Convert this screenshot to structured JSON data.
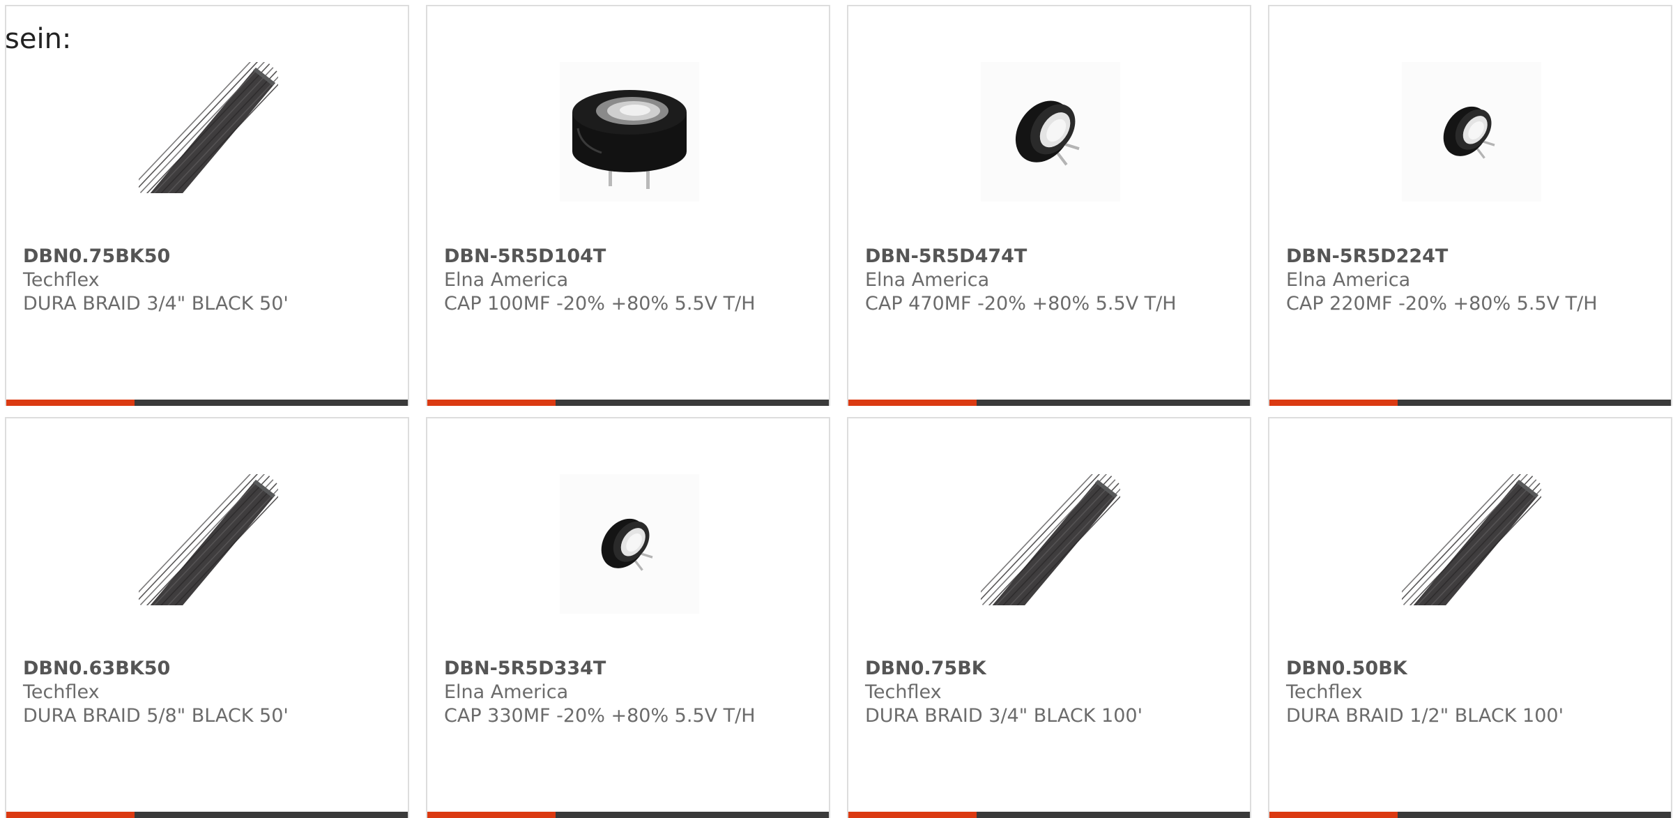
{
  "intro_text": "sein:",
  "colors": {
    "accent": "#db3a12",
    "bar_track": "#3a3a3a",
    "part_number": "#555555",
    "body_text": "#6b6b6b",
    "card_border": "#dddddd"
  },
  "products": [
    {
      "part_number": "DBN0.75BK50",
      "manufacturer": "Techflex",
      "description": "DURA BRAID 3/4\" BLACK 50'",
      "image": "black-braided-sleeve-icon",
      "bar_fill_fraction": 0.32
    },
    {
      "part_number": "DBN-5R5D104T",
      "manufacturer": "Elna America",
      "description": "CAP 100MF -20% +80% 5.5V T/H",
      "image": "supercapacitor-icon",
      "bar_fill_fraction": 0.32
    },
    {
      "part_number": "DBN-5R5D474T",
      "manufacturer": "Elna America",
      "description": "CAP 470MF -20% +80% 5.5V T/H",
      "image": "supercapacitor-icon",
      "bar_fill_fraction": 0.32
    },
    {
      "part_number": "DBN-5R5D224T",
      "manufacturer": "Elna America",
      "description": "CAP 220MF -20% +80% 5.5V T/H",
      "image": "supercapacitor-icon",
      "bar_fill_fraction": 0.32
    },
    {
      "part_number": "DBN0.63BK50",
      "manufacturer": "Techflex",
      "description": "DURA BRAID 5/8\" BLACK 50'",
      "image": "black-braided-sleeve-icon",
      "bar_fill_fraction": 0.32
    },
    {
      "part_number": "DBN-5R5D334T",
      "manufacturer": "Elna America",
      "description": "CAP 330MF -20% +80% 5.5V T/H",
      "image": "supercapacitor-icon",
      "bar_fill_fraction": 0.32
    },
    {
      "part_number": "DBN0.75BK",
      "manufacturer": "Techflex",
      "description": "DURA BRAID 3/4\" BLACK 100'",
      "image": "black-braided-sleeve-icon",
      "bar_fill_fraction": 0.32
    },
    {
      "part_number": "DBN0.50BK",
      "manufacturer": "Techflex",
      "description": "DURA BRAID 1/2\" BLACK 100'",
      "image": "black-braided-sleeve-icon",
      "bar_fill_fraction": 0.32
    }
  ]
}
